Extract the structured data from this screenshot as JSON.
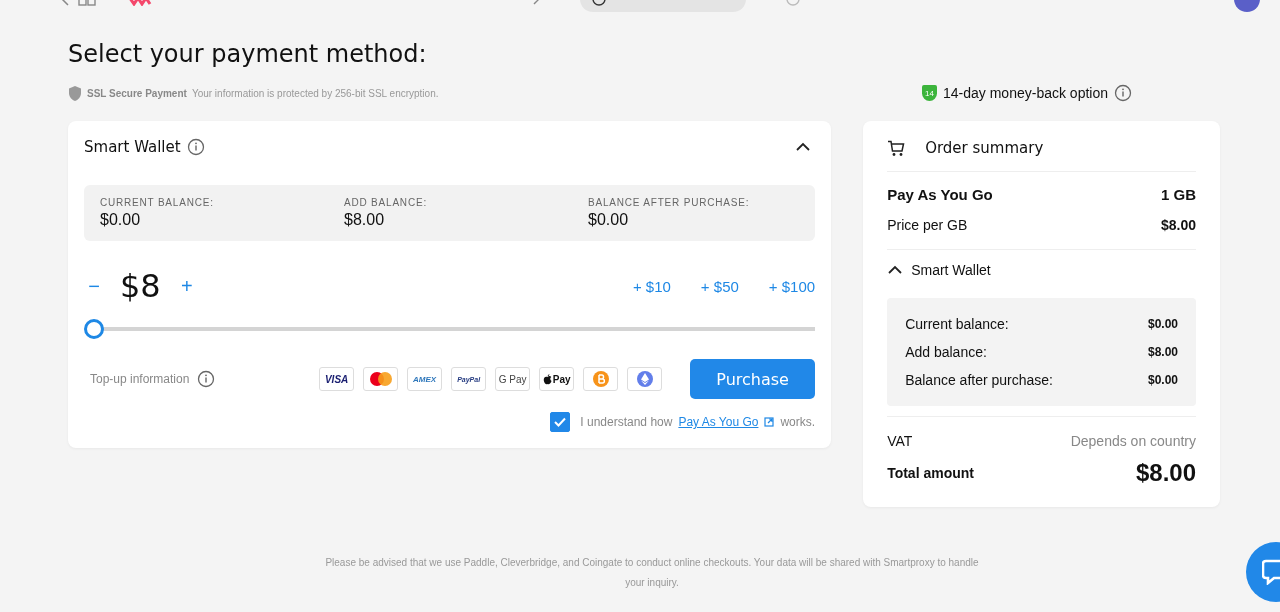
{
  "header": {
    "steps": [
      {
        "kind": "link"
      },
      {
        "kind": "current"
      },
      {
        "kind": "upcoming"
      }
    ]
  },
  "title": "Select your payment method:",
  "security": {
    "label": "SSL Secure Payment",
    "text": "Your information is protected by 256-bit SSL encryption."
  },
  "money_back": {
    "badge": "14",
    "label": "14-day money-back option"
  },
  "wallet": {
    "title": "Smart Wallet",
    "expanded": true,
    "balances": [
      {
        "label": "CURRENT BALANCE:",
        "value": "$0.00"
      },
      {
        "label": "ADD BALANCE:",
        "value": "$8.00"
      },
      {
        "label": "BALANCE AFTER PURCHASE:",
        "value": "$0.00"
      }
    ],
    "minus": "−",
    "amount": "$8",
    "plus": "+",
    "quick_adds": [
      {
        "sign": "+",
        "label": "$10"
      },
      {
        "sign": "+",
        "label": "$50"
      },
      {
        "sign": "+",
        "label": "$100"
      }
    ],
    "slider": {
      "level": 0
    },
    "topup_info": "Top-up information",
    "payment_methods": [
      {
        "kind": "visa",
        "label": "VISA"
      },
      {
        "kind": "mastercard"
      },
      {
        "kind": "amex",
        "label": "AMEX"
      },
      {
        "kind": "paypal",
        "label": "PayPal"
      },
      {
        "kind": "gpay",
        "label": "G Pay"
      },
      {
        "kind": "applepay",
        "label": "Pay"
      },
      {
        "kind": "bitcoin"
      },
      {
        "kind": "ethereum"
      }
    ],
    "purchase": "Purchase",
    "agree": {
      "checked": true,
      "before": "I understand how",
      "link": "Pay As You Go",
      "after": "works."
    }
  },
  "summary": {
    "title": "Order summary",
    "plan": "Pay As You Go",
    "quantity": "1 GB",
    "price_label": "Price per GB",
    "price": "$8.00",
    "wallet": {
      "title": "Smart Wallet",
      "expanded": true,
      "rows": [
        {
          "label": "Current balance:",
          "value": "$0.00"
        },
        {
          "label": "Add balance:",
          "value": "$8.00"
        },
        {
          "label": "Balance after purchase:",
          "value": "$0.00"
        }
      ]
    },
    "vat_label": "VAT",
    "vat": "Depends on country",
    "total_label": "Total amount",
    "total": "$8.00"
  },
  "footer": "Please be advised that we use Paddle, Cleverbridge, and Coingate to conduct online checkouts. Your data will be shared with Smartproxy to handle your inquiry."
}
